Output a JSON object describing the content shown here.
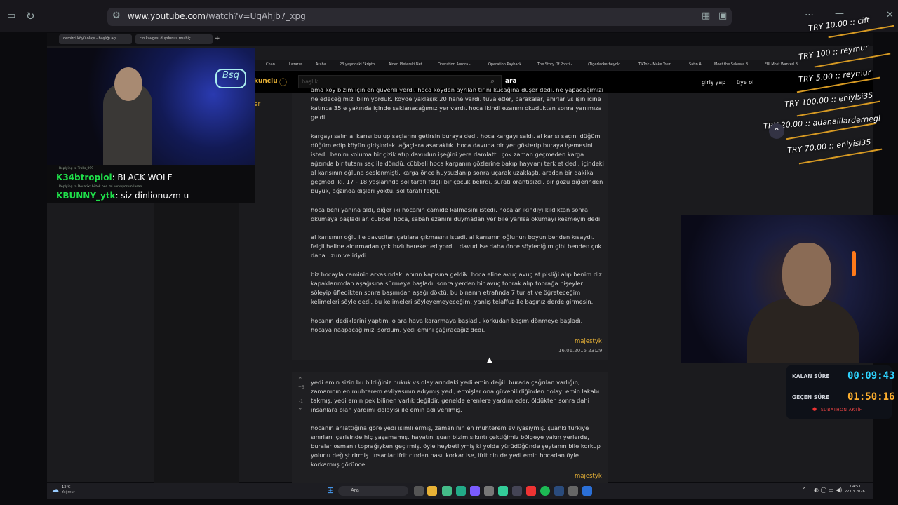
{
  "outer_browser": {
    "url_host": "www.youtube.com",
    "url_path": "/watch?v=UqAhjb7_xpg"
  },
  "inner_tabs": [
    {
      "label": "demirci köyü olayı - başlığı açı…"
    },
    {
      "label": "cin kavgası duydunuz mu hiç"
    }
  ],
  "bookmarks": [
    "Chan",
    "Lazarus",
    "Araba",
    "23 yaşındaki \"kripto…",
    "Aiden Pleterski Net…",
    "Operation Aurora -…",
    "Operation Payback…",
    "The Story Of Ponzi -…",
    "(Tigerlackerbeyolc…",
    "TikTok - Make Your…",
    "Satın Al",
    "Meet the Sakawa B…",
    "FBI Most Wanted B…"
  ],
  "site": {
    "brand_partial": "kunclu",
    "search_placeholder": "başlık",
    "search_button": "ara",
    "login": "giriş yap",
    "register": "üye ol",
    "left_partial": "er"
  },
  "entry1": {
    "paragraphs": [
      "ama köy bizim için en güvenli yerdi. hoca köyden ayrılan tırını kucağına düşer dedi. ne yapacağımızı ne edeceğimizi bilmiyorduk. köyde yaklaşık 20 hane vardı. tuvaletler, barakalar, ahırlar vs işin içine katınca 35 e yakında içinde saklanacağımız yer vardı. hoca ikindi ezanını okuduktan sonra yanımıza geldi.",
      "kargayı salın al karısı bulup saçlarını getirsin buraya dedi. hoca kargayı saldı. al karısı saçını düğüm düğüm edip köyün girişindeki ağaçlara asacaktık. hoca davuda bir yer gösterip buraya işemesini istedi. benim koluma bir çizik atıp davudun işeğini yere damlattı. çok zaman geçmeden karga ağzında bir tutam saç ile döndü. cübbeli hoca karganın gözlerine bakıp hayvanı terk et dedi. içindeki al karısının oğluna seslenmişti. karga önce huysuzlanıp sonra uçarak uzaklaştı. aradan bir dakika geçmedi ki, 17 - 18 yaşlarında sol tarafı felçli bir çocuk belirdi. suratı orantısızdı. bir gözü diğerinden büyük, ağzında dişleri yoktu. sol tarafı felçti.",
      "hoca beni yanına aldı, diğer iki hocanın camide kalmasını istedi. hocalar ikindiyi kıldıktan sonra okumaya başladılar. cübbeli hoca, sabah ezanını duymadan yer bile yarılsa okumayı kesmeyin dedi.",
      "al karısının oğlu ile davudtan çatılara çıkmasını istedi. al karısının oğlunun boyun benden kısaydı. felçli haline aldırmadan çok hızlı hareket ediyordu. davud ise daha önce söylediğim gibi benden çok daha uzun ve iriydi.",
      "biz hocayla caminin arkasındaki ahırın kapısına geldik. hoca eline avuç avuç at pisliği alıp benim diz kapaklarımdan aşağısına sürmeye başladı. sonra yerden bir avuç toprak alıp toprağa bişeyler söleyip üfledikten sonra başımdan aşağı döktü. bu binanın etrafında 7 tur at ve öğreteceğim kelimeleri söyle dedi. bu kelimeleri söyleyemeyeceğim, yanlış telaffuz ile başınız derde girmesin.",
      "hocanın dediklerini yaptım. o ara hava kararmaya başladı. korkudan başım dönmeye başladı. hocaya naapacağımızı sordum. yedi emini çağıracağız dedi."
    ],
    "author": "majestyk",
    "date": "16.01.2015 23:29"
  },
  "entry2": {
    "vote_up": "+5",
    "vote_down": "-1",
    "paragraphs": [
      "yedi emin sizin bu bildiğiniz hukuk vs olaylarındaki yedi emin değil. burada çağrılan varlığın, zamanının en muhterem evliyasının adıymış yedi, ermişler ona güvenilirliğinden dolayı emin lakabı takmış. yedi emin pek bilinen varlık değildir. genelde erenlere yardım eder. öldükten sonra dahi insanlara olan yardımı dolayısı ile emin adı verilmiş.",
      "hocanın anlattığına göre yedi isimli ermiş, zamanının en muhterem evliyasıymış. şuanki türkiye sınırları içerisinde hiç yaşamamış. hayatını şuan bizim sıkıntı çektiğimiz bölgeye yakın yerlerde, buralar osmanlı toprağıyken geçirmiş. öyle heybetliymiş ki yolda yürüdüğünde şeytanın bile korkup yolunu değiştirirmiş. insanlar ifrit cinden nasıl korkar ise, ifrit cin de yedi emin hocadan öyle korkarmış görünce."
    ],
    "author": "majestyk"
  },
  "chat": {
    "line1_reply": "Replying to  Trolls_099",
    "line1_user": "34btroplol",
    "line1_msg": "BLACK WOLF",
    "line2_reply": "Replying to  Dosarix: bi tek ben mi korkuyorum lasan",
    "line2_user": "BUNNY_ytk",
    "line2_msg": "siz dinlionuzm u"
  },
  "donations": [
    {
      "text": "TRY 10.00 :: cift"
    },
    {
      "text": "TRY 100 :: reymur"
    },
    {
      "text": "TRY 5.00 :: reymur"
    },
    {
      "text": "TRY 100.00 :: eniyisi35"
    },
    {
      "text": "TRY 20.00 :: adanalilardernegi"
    },
    {
      "text": "TRY 70.00 :: eniyisi35"
    }
  ],
  "timer": {
    "remaining_label": "KALAN SÜRE",
    "remaining_value": "00:09:43",
    "elapsed_label": "GEÇEN SÜRE",
    "elapsed_value": "01:50:16",
    "status": "SUBATHON AKTİF"
  },
  "taskbar": {
    "weather_temp": "13°C",
    "weather_desc": "Yağmur",
    "search": "Ara",
    "time": "04:53",
    "date": "22.03.2026"
  },
  "colors": {
    "accent_gold": "#e8b236",
    "chat_green": "#1fe04a",
    "timer_cyan": "#2ed3ff",
    "timer_orange": "#ffb02e"
  }
}
